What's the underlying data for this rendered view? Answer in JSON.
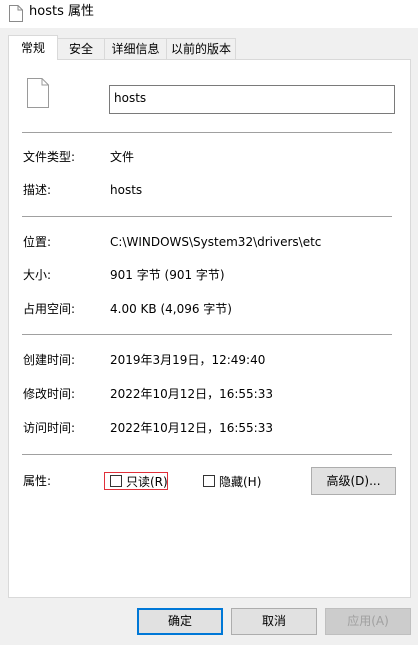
{
  "window": {
    "title": "hosts 属性",
    "title_icon": "file-icon"
  },
  "tabs": [
    {
      "label": "常规",
      "active": true
    },
    {
      "label": "安全",
      "active": false
    },
    {
      "label": "详细信息",
      "active": false
    },
    {
      "label": "以前的版本",
      "active": false
    }
  ],
  "file": {
    "icon": "blank-file-icon",
    "name": "hosts"
  },
  "info": {
    "type_label": "文件类型:",
    "type_value": "文件",
    "desc_label": "描述:",
    "desc_value": "hosts",
    "location_label": "位置:",
    "location_value": "C:\\WINDOWS\\System32\\drivers\\etc",
    "size_label": "大小:",
    "size_value": "901 字节 (901 字节)",
    "disk_label": "占用空间:",
    "disk_value": "4.00 KB (4,096 字节)",
    "created_label": "创建时间:",
    "created_value": "2019年3月19日，12:49:40",
    "modified_label": "修改时间:",
    "modified_value": "2022年10月12日，16:55:33",
    "accessed_label": "访问时间:",
    "accessed_value": "2022年10月12日，16:55:33"
  },
  "attributes": {
    "label": "属性:",
    "readonly": {
      "label": "只读(R)",
      "checked": false
    },
    "hidden": {
      "label": "隐藏(H)",
      "checked": false
    },
    "advanced_button": "高级(D)..."
  },
  "buttons": {
    "ok": "确定",
    "cancel": "取消",
    "apply": "应用(A)"
  },
  "colors": {
    "focus_border": "#e0303a",
    "default_button_border": "#0078d7"
  }
}
